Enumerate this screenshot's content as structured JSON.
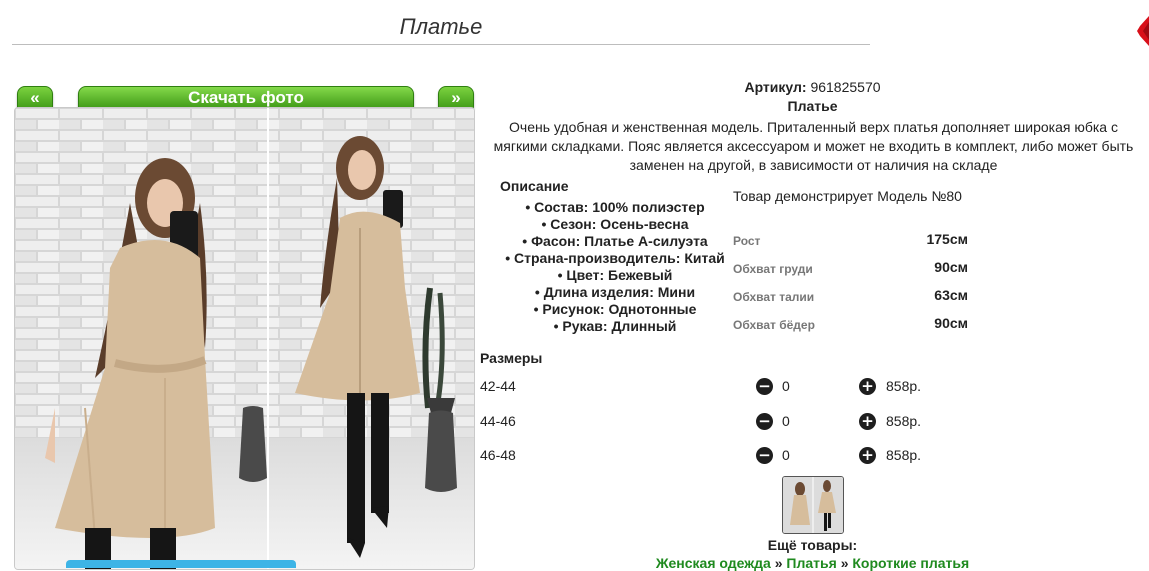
{
  "header": {
    "title": "Платье"
  },
  "gallery": {
    "prev_label": "«",
    "next_label": "»",
    "download_label": "Скачать фото"
  },
  "product": {
    "article_label": "Артикул:",
    "article_value": "961825570",
    "name": "Платье",
    "description": "Очень удобная и женственная модель. Приталенный верх платья дополняет широкая юбка с мягкими складками. Пояс является аксессуаром и может не входить в комплект, либо может быть заменен на другой, в зависимости от наличия на складе"
  },
  "specs": {
    "heading": "Описание",
    "items": [
      "Состав: 100% полиэстер",
      "Сезон: Осень-весна",
      "Фасон: Платье А-силуэта",
      "Страна-производитель: Китай",
      "Цвет: Бежевый",
      "Длина изделия: Мини",
      "Рисунок: Однотонные",
      "Рукав: Длинный"
    ]
  },
  "model": {
    "text": "Товар демонстрирует Модель №80",
    "measurements": [
      {
        "label": "Рост",
        "value": "175см"
      },
      {
        "label": "Обхват груди",
        "value": "90см"
      },
      {
        "label": "Обхват талии",
        "value": "63см"
      },
      {
        "label": "Обхват бёдер",
        "value": "90см"
      }
    ]
  },
  "sizes": {
    "heading": "Размеры",
    "rows": [
      {
        "size": "42-44",
        "qty": "0",
        "price": "858р.",
        "minus": "−",
        "plus": "+"
      },
      {
        "size": "44-46",
        "qty": "0",
        "price": "858р.",
        "minus": "−",
        "plus": "+"
      },
      {
        "size": "46-48",
        "qty": "0",
        "price": "858р.",
        "minus": "−",
        "plus": "+"
      }
    ]
  },
  "more": {
    "heading": "Ещё товары:",
    "crumbs": [
      "Женская одежда",
      "Платья",
      "Короткие платья"
    ],
    "separator": "»"
  },
  "colors": {
    "accent_green": "#3f9a17",
    "link_green": "#1f8a1f",
    "close_red": "#d8101a"
  },
  "icons": [
    "close-icon",
    "minus-circle-icon",
    "plus-circle-icon"
  ]
}
